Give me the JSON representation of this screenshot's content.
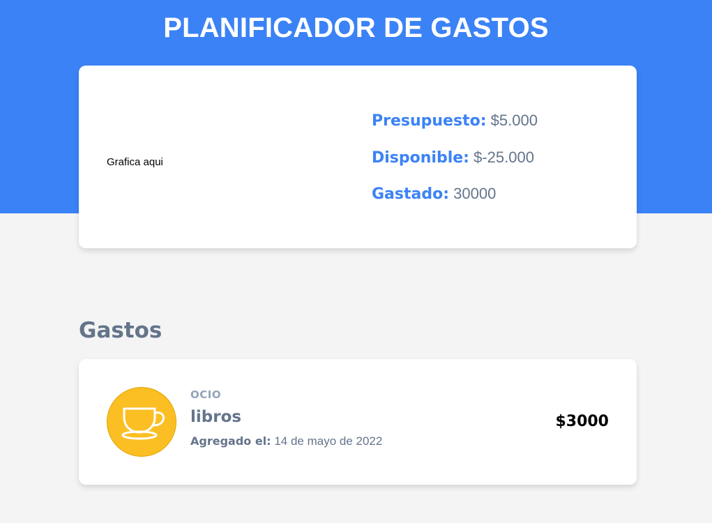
{
  "header": {
    "title": "PLANIFICADOR DE GASTOS"
  },
  "budget": {
    "chart_placeholder": "Grafica aqui",
    "presupuesto_label": "Presupuesto:",
    "presupuesto_value": "$5.000",
    "disponible_label": "Disponible:",
    "disponible_value": "$-25.000",
    "gastado_label": "Gastado:",
    "gastado_value": "30000"
  },
  "expenses": {
    "section_title": "Gastos",
    "items": [
      {
        "category": "OCIO",
        "name": "libros",
        "date_label": "Agregado el:",
        "date": "14 de mayo de 2022",
        "amount": "$3000",
        "icon": "cup-icon"
      }
    ]
  },
  "colors": {
    "primary": "#3b82f6",
    "background": "#f4f4f4",
    "text_muted": "#64748b",
    "category_muted": "#94a3b8",
    "icon_bg": "#fbbf24"
  }
}
